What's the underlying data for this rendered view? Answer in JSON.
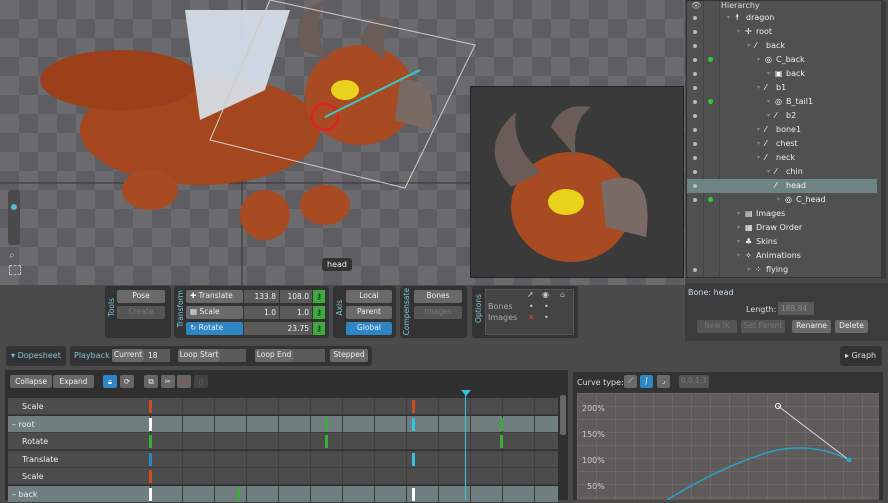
{
  "viewport": {
    "tooltip": "head"
  },
  "hierarchy": {
    "title": "Hierarchy",
    "items": [
      {
        "label": "dragon",
        "depth": 0,
        "icon": "skeleton-icon"
      },
      {
        "label": "root",
        "depth": 1,
        "icon": "root-icon"
      },
      {
        "label": "back",
        "depth": 2,
        "icon": "bone-icon"
      },
      {
        "label": "C_back",
        "depth": 3,
        "icon": "slot-icon",
        "key": true
      },
      {
        "label": "back",
        "depth": 4,
        "icon": "image-icon"
      },
      {
        "label": "b1",
        "depth": 3,
        "icon": "bone-icon"
      },
      {
        "label": "B_tail1",
        "depth": 4,
        "icon": "slot-icon",
        "key": true
      },
      {
        "label": "b2",
        "depth": 4,
        "icon": "bone-icon"
      },
      {
        "label": "bone1",
        "depth": 3,
        "icon": "bone-icon"
      },
      {
        "label": "chest",
        "depth": 3,
        "icon": "bone-icon"
      },
      {
        "label": "neck",
        "depth": 3,
        "icon": "bone-icon"
      },
      {
        "label": "chin",
        "depth": 4,
        "icon": "bone-icon"
      },
      {
        "label": "head",
        "depth": 4,
        "icon": "bone-icon",
        "selected": true
      },
      {
        "label": "C_head",
        "depth": 5,
        "icon": "slot-icon",
        "key": true
      },
      {
        "label": "Images",
        "depth": 1,
        "icon": "folder-icon",
        "novis": true
      },
      {
        "label": "Draw Order",
        "depth": 1,
        "icon": "draw-order-icon",
        "novis": true
      },
      {
        "label": "Skins",
        "depth": 1,
        "icon": "skins-icon",
        "novis": true
      },
      {
        "label": "Animations",
        "depth": 1,
        "icon": "animations-icon",
        "novis": true
      },
      {
        "label": "flying",
        "depth": 2,
        "icon": "animation-icon"
      }
    ]
  },
  "tools": {
    "title": "Tools",
    "pose": "Pose",
    "create": "Create",
    "transform_title": "Transform",
    "translate": {
      "label": "Translate",
      "x": "133.8",
      "y": "108.0"
    },
    "scale": {
      "label": "Scale",
      "x": "1.0",
      "y": "1.0"
    },
    "rotate": {
      "label": "Rotate",
      "value": "23.75"
    },
    "axis_title": "Axis",
    "local": "Local",
    "parent": "Parent",
    "global": "Global",
    "compensate_title": "Compensate",
    "bones": "Bones",
    "images": "Images",
    "options_title": "Options",
    "opt_bones": "Bones",
    "opt_images": "Images"
  },
  "bone_panel": {
    "title": "Bone: head",
    "length_label": "Length:",
    "length": "188.84",
    "new_ik": "New IK",
    "set_parent": "Set Parent",
    "rename": "Rename",
    "delete": "Delete"
  },
  "dopesheet": {
    "title": "Dopesheet",
    "playback": "Playback",
    "current_label": "Current",
    "current": "18",
    "loop_start": "Loop Start",
    "loop_end": "Loop End",
    "stepped": "Stepped",
    "collapse": "Collapse",
    "expand": "Expand",
    "rows": [
      {
        "label": "Scale",
        "group": false
      },
      {
        "label": "root",
        "group": true
      },
      {
        "label": "Rotate",
        "group": false
      },
      {
        "label": "Translate",
        "group": false
      },
      {
        "label": "Scale",
        "group": false
      },
      {
        "label": "back",
        "group": true
      }
    ]
  },
  "graph": {
    "toggle": "Graph",
    "curve_type": "Curve type:",
    "values_btn": "0,0,1,1",
    "y_ticks": [
      "200%",
      "150%",
      "100%",
      "50%"
    ]
  },
  "colors": {
    "accent": "#2f86c4",
    "key_green": "#3eaa3e",
    "key_red": "#d04a20",
    "key_cyan": "#35c4e0",
    "playhead": "#35c4e0"
  }
}
